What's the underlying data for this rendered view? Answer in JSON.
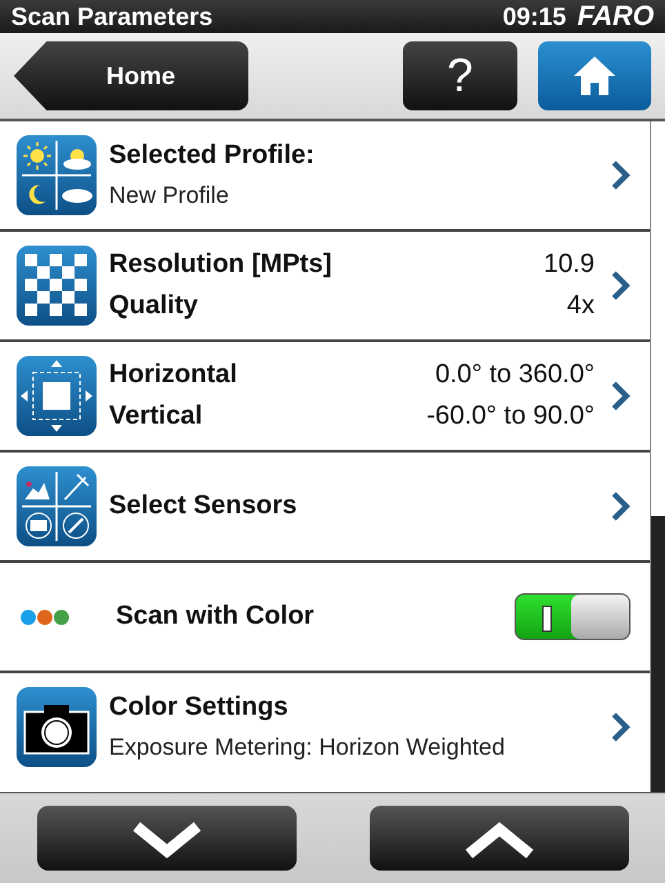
{
  "title_bar": {
    "title": "Scan Parameters",
    "time": "09:15",
    "logo": "FARO"
  },
  "nav": {
    "back": "Home",
    "help": "?"
  },
  "rows": [
    {
      "kind": "link",
      "lines": [
        {
          "kind": "heading",
          "label": "Selected Profile:"
        },
        {
          "kind": "detail",
          "label": "New Profile"
        }
      ]
    },
    {
      "kind": "link",
      "lines": [
        {
          "kind": "heading",
          "label": "Resolution [MPts]",
          "value": "10.9"
        },
        {
          "kind": "heading",
          "label": "Quality",
          "value": "4x"
        }
      ]
    },
    {
      "kind": "link",
      "lines": [
        {
          "kind": "heading",
          "label": "Horizontal",
          "value": "0.0° to 360.0°"
        },
        {
          "kind": "heading",
          "label": "Vertical",
          "value": "-60.0° to 90.0°"
        }
      ]
    },
    {
      "kind": "link",
      "lines": [
        {
          "kind": "heading",
          "label": "Select Sensors"
        }
      ]
    },
    {
      "kind": "toggle",
      "on": true,
      "lines": [
        {
          "kind": "heading",
          "label": "Scan with Color"
        }
      ]
    },
    {
      "kind": "link",
      "lines": [
        {
          "kind": "heading",
          "label": "Color Settings"
        },
        {
          "kind": "detail",
          "label": "Exposure Metering: Horizon Weighted"
        }
      ]
    }
  ]
}
